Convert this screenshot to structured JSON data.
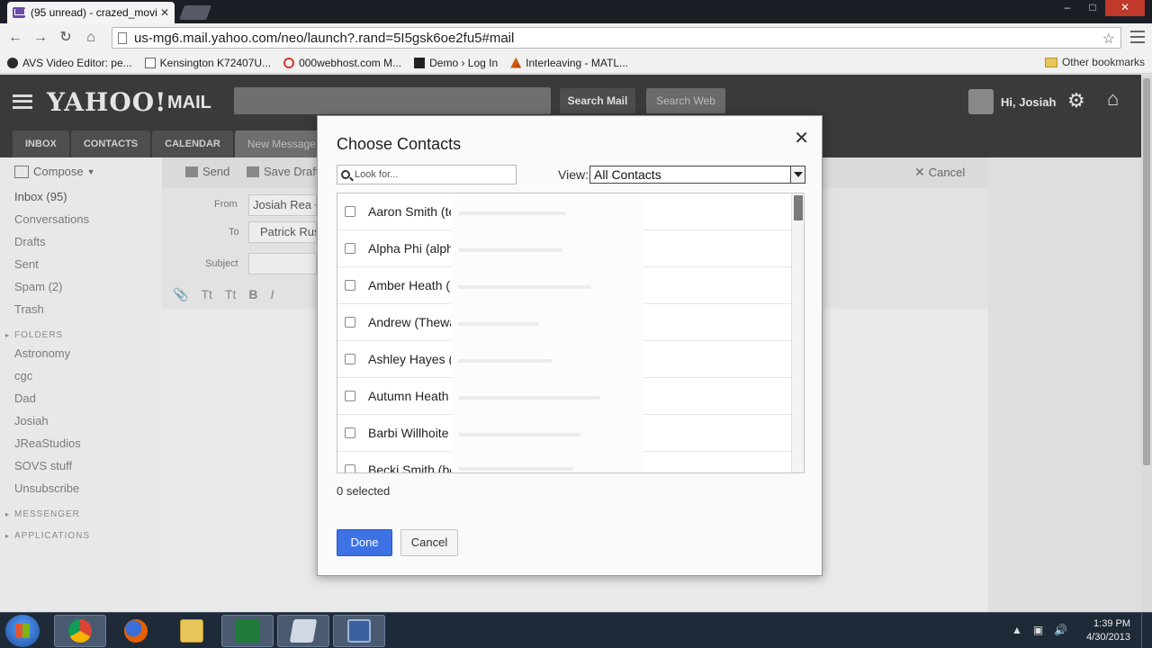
{
  "browser": {
    "tab_title": "(95 unread) - crazed_movi",
    "tab_close": "✕",
    "url": "us-mg6.mail.yahoo.com/neo/launch?.rand=5I5gsk6oe2fu5#mail",
    "bookmarks": [
      {
        "label": "AVS Video Editor: pe...",
        "color": "#2b2b2b"
      },
      {
        "label": "Kensington K72407U...",
        "color": "#ffffff"
      },
      {
        "label": "000webhost.com M...",
        "color": "#d23b2b"
      },
      {
        "label": "Demo › Log In",
        "color": "#222222"
      },
      {
        "label": "Interleaving - MATL...",
        "color": "#e0801a"
      }
    ],
    "other_bookmarks": "Other bookmarks"
  },
  "yahoo": {
    "logo": "YAHOO!",
    "mail": "MAIL",
    "search_mail_button": "Search Mail",
    "search_web_button": "Search Web",
    "greeting": "Hi, Josiah",
    "tabs": [
      "INBOX",
      "CONTACTS",
      "CALENDAR",
      "New Message"
    ]
  },
  "leftnav": {
    "compose": "Compose",
    "items": [
      "Inbox (95)",
      "Conversations",
      "Drafts",
      "Sent",
      "Spam (2)",
      "Trash"
    ],
    "folders_header": "FOLDERS",
    "folders": [
      "Astronomy",
      "cgc",
      "Dad",
      "Josiah",
      "JReaStudios",
      "SOVS stuff",
      "Unsubscribe"
    ],
    "messenger_header": "MESSENGER",
    "applications_header": "APPLICATIONS"
  },
  "compose": {
    "send": "Send",
    "save_draft": "Save Draft",
    "cancel": "Cancel",
    "from_label": "From",
    "from_value": "Josiah Rea <",
    "to_label": "To",
    "to_value": "Patrick Rus",
    "subject_label": "Subject",
    "format_buttons": [
      "Tt",
      "Tt",
      "B",
      "I"
    ]
  },
  "dialog": {
    "title": "Choose Contacts",
    "close": "✕",
    "search_placeholder": "Look for...",
    "view_label": "View:",
    "view_value": "All Contacts",
    "contacts": [
      "Aaron Smith (te",
      "Alpha Phi (alpha",
      "Amber Heath (h",
      "Andrew (Thewal",
      "Ashley Hayes (",
      "Autumn Heath (",
      "Barbi Willhoite (",
      "Becki Smith (be"
    ],
    "selected_text": "0 selected",
    "done_button": "Done",
    "cancel_button": "Cancel"
  },
  "taskbar": {
    "time": "1:39 PM",
    "date": "4/30/2013"
  }
}
